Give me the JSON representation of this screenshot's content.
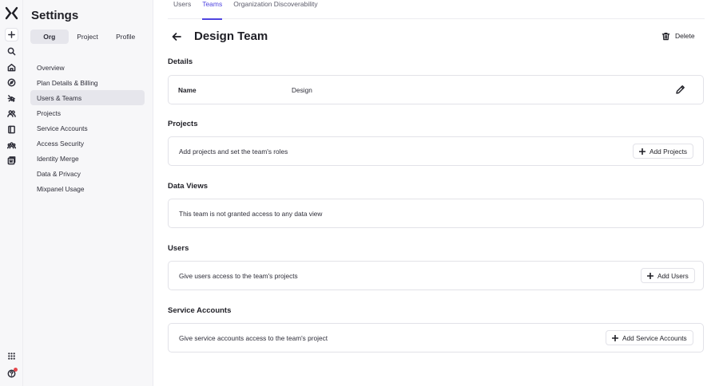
{
  "rail": {
    "icons": [
      "mixpanel-logo-icon",
      "plus-icon",
      "search-icon",
      "home-icon",
      "compass-icon",
      "lightning-icon",
      "users-icon",
      "book-icon",
      "team-icon",
      "bookmark-icon",
      "apps-grid-icon",
      "help-icon"
    ]
  },
  "sidebar": {
    "title": "Settings",
    "segments": [
      "Org",
      "Project",
      "Profile"
    ],
    "active_segment": "Org",
    "items": [
      {
        "label": "Overview"
      },
      {
        "label": "Plan Details & Billing"
      },
      {
        "label": "Users & Teams"
      },
      {
        "label": "Projects"
      },
      {
        "label": "Service Accounts"
      },
      {
        "label": "Access Security"
      },
      {
        "label": "Identity Merge"
      },
      {
        "label": "Data & Privacy"
      },
      {
        "label": "Mixpanel Usage"
      }
    ],
    "active_item": "Users & Teams"
  },
  "tabs": [
    {
      "label": "Users"
    },
    {
      "label": "Teams"
    },
    {
      "label": "Organization Discoverability"
    }
  ],
  "active_tab": "Teams",
  "header": {
    "title": "Design Team",
    "delete_label": "Delete"
  },
  "details": {
    "title": "Details",
    "name_label": "Name",
    "name_value": "Design"
  },
  "projects": {
    "title": "Projects",
    "text": "Add projects and set the team's roles",
    "button": "Add Projects"
  },
  "data_views": {
    "title": "Data Views",
    "text": "This team is not granted access to any data view"
  },
  "users": {
    "title": "Users",
    "text": "Give users access to the team's projects",
    "button": "Add Users"
  },
  "service_accounts": {
    "title": "Service Accounts",
    "text": "Give service accounts access to the team's project",
    "button": "Add Service Accounts"
  },
  "colors": {
    "accent": "#4f44e0",
    "notification": "#e5484d"
  }
}
